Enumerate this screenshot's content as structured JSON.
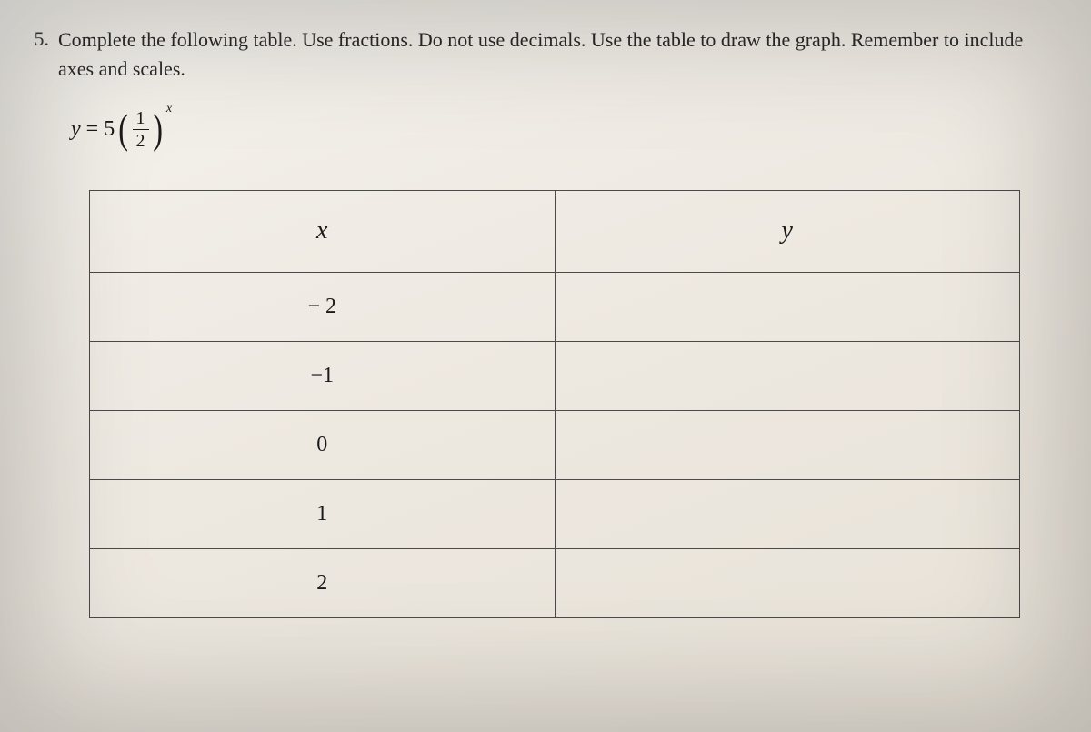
{
  "question": {
    "number": "5.",
    "text": "Complete the following table. Use fractions. Do not use decimals. Use the table to draw the graph. Remember to include axes and scales."
  },
  "equation": {
    "lhs": "y",
    "equals": "=",
    "coefficient": "5",
    "lparen": "(",
    "fraction_num": "1",
    "fraction_den": "2",
    "rparen": ")",
    "exponent": "x"
  },
  "table": {
    "headers": {
      "x": "x",
      "y": "y"
    },
    "rows": [
      {
        "x": "− 2",
        "y": ""
      },
      {
        "x": "−1",
        "y": ""
      },
      {
        "x": "0",
        "y": ""
      },
      {
        "x": "1",
        "y": ""
      },
      {
        "x": "2",
        "y": ""
      }
    ]
  },
  "chart_data": {
    "type": "table",
    "title": "Function table for y = 5(1/2)^x",
    "columns": [
      "x",
      "y"
    ],
    "rows": [
      {
        "x": -2,
        "y": null
      },
      {
        "x": -1,
        "y": null
      },
      {
        "x": 0,
        "y": null
      },
      {
        "x": 1,
        "y": null
      },
      {
        "x": 2,
        "y": null
      }
    ]
  }
}
